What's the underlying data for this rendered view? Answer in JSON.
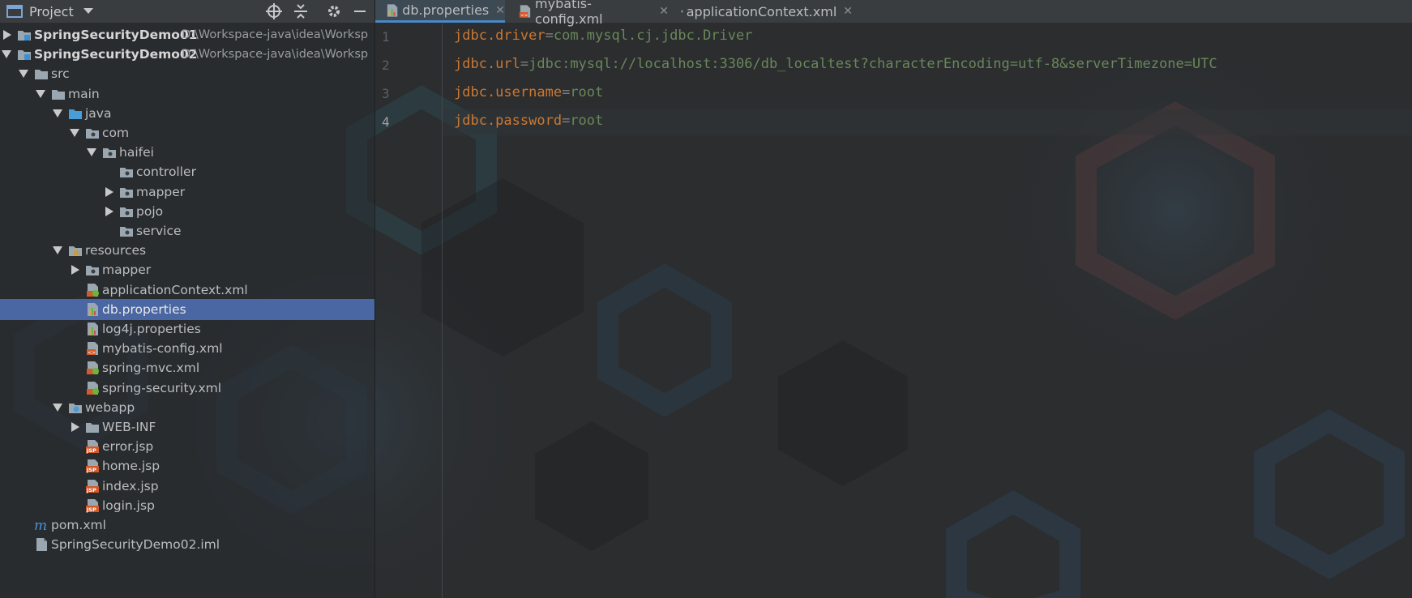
{
  "project_panel": {
    "title": "Project",
    "tree": [
      {
        "label": "SpringSecurityDemo01",
        "path": "D:\\Workspace-java\\idea\\Worksp",
        "icon": "module-folder-icon",
        "expanded": false,
        "depth": 0
      },
      {
        "label": "SpringSecurityDemo02",
        "path": "D:\\Workspace-java\\idea\\Worksp",
        "icon": "module-folder-icon",
        "expanded": true,
        "depth": 0
      },
      {
        "label": "src",
        "icon": "folder-icon",
        "expanded": true,
        "depth": 1
      },
      {
        "label": "main",
        "icon": "folder-icon",
        "expanded": true,
        "depth": 2
      },
      {
        "label": "java",
        "icon": "source-folder-icon",
        "expanded": true,
        "depth": 3
      },
      {
        "label": "com",
        "icon": "package-icon",
        "expanded": true,
        "depth": 4
      },
      {
        "label": "haifei",
        "icon": "package-icon",
        "expanded": true,
        "depth": 5
      },
      {
        "label": "controller",
        "icon": "package-icon",
        "depth": 6
      },
      {
        "label": "mapper",
        "icon": "package-icon",
        "expanded": false,
        "depth": 6
      },
      {
        "label": "pojo",
        "icon": "package-icon",
        "expanded": false,
        "depth": 6
      },
      {
        "label": "service",
        "icon": "package-icon",
        "depth": 6
      },
      {
        "label": "resources",
        "icon": "resources-folder-icon",
        "expanded": true,
        "depth": 3
      },
      {
        "label": "mapper",
        "icon": "package-icon",
        "expanded": false,
        "depth": 4
      },
      {
        "label": "applicationContext.xml",
        "icon": "spring-xml-icon",
        "depth": 4
      },
      {
        "label": "db.properties",
        "icon": "properties-icon",
        "depth": 4,
        "selected": true
      },
      {
        "label": "log4j.properties",
        "icon": "properties-icon",
        "depth": 4
      },
      {
        "label": "mybatis-config.xml",
        "icon": "xml-icon",
        "depth": 4
      },
      {
        "label": "spring-mvc.xml",
        "icon": "spring-xml-icon",
        "depth": 4
      },
      {
        "label": "spring-security.xml",
        "icon": "spring-xml-icon",
        "depth": 4
      },
      {
        "label": "webapp",
        "icon": "web-folder-icon",
        "expanded": true,
        "depth": 3
      },
      {
        "label": "WEB-INF",
        "icon": "folder-icon",
        "expanded": false,
        "depth": 4
      },
      {
        "label": "error.jsp",
        "icon": "jsp-icon",
        "depth": 4
      },
      {
        "label": "home.jsp",
        "icon": "jsp-icon",
        "depth": 4
      },
      {
        "label": "index.jsp",
        "icon": "jsp-icon",
        "depth": 4
      },
      {
        "label": "login.jsp",
        "icon": "jsp-icon",
        "depth": 4
      },
      {
        "label": "pom.xml",
        "icon": "maven-icon",
        "depth": 1
      },
      {
        "label": "SpringSecurityDemo02.iml",
        "icon": "iml-icon",
        "depth": 1
      }
    ]
  },
  "tabs": [
    {
      "label": "db.properties",
      "icon": "properties-icon",
      "active": true
    },
    {
      "label": "mybatis-config.xml",
      "icon": "xml-icon",
      "active": false
    },
    {
      "label": "applicationContext.xml",
      "icon": "spring-xml-icon",
      "active": false
    }
  ],
  "editor": {
    "current_line": 4,
    "lines": [
      {
        "num": "1",
        "key": "jdbc.driver",
        "eq": "=",
        "value": "com.mysql.cj.jdbc.Driver"
      },
      {
        "num": "2",
        "key": "jdbc.url",
        "eq": "=",
        "value": "jdbc:mysql://localhost:3306/db_localtest?characterEncoding=utf-8&serverTimezone=UTC"
      },
      {
        "num": "3",
        "key": "jdbc.username",
        "eq": "=",
        "value": "root"
      },
      {
        "num": "4",
        "key": "jdbc.password",
        "eq": "=",
        "value": "root"
      }
    ]
  },
  "colors": {
    "selection": "#4a67a3",
    "key": "#cc7832",
    "value": "#6a8759",
    "active_tab_underline": "#4a88c7"
  }
}
